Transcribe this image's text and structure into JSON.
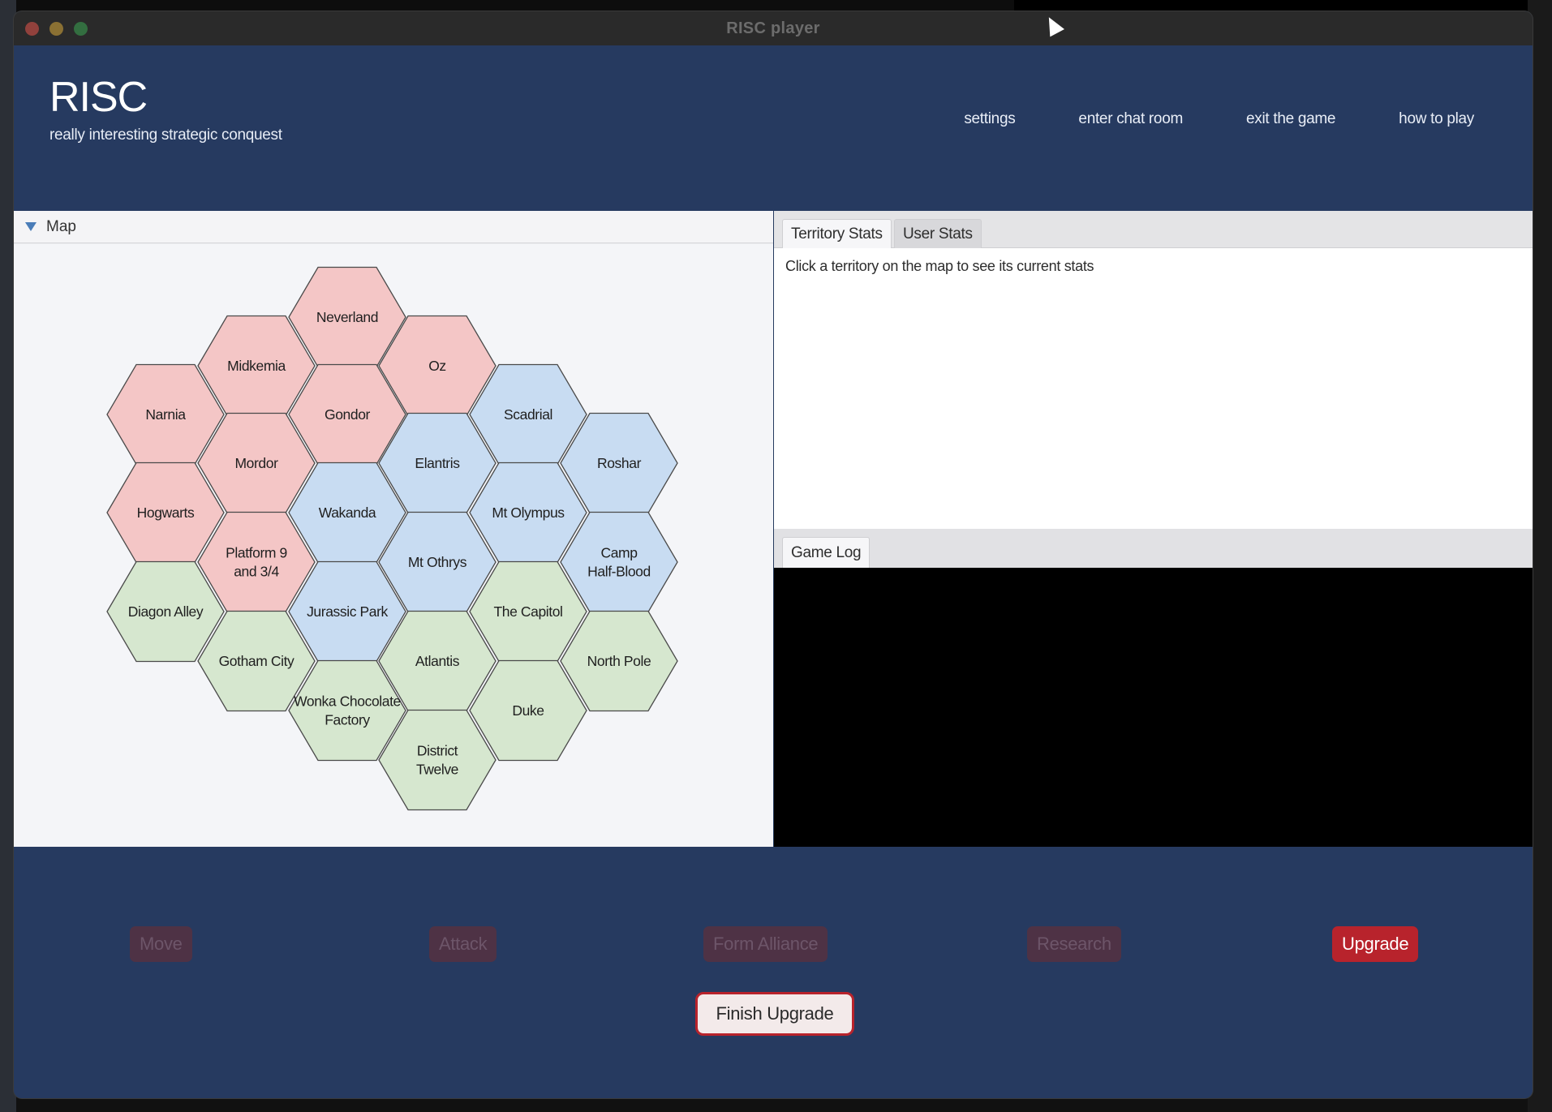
{
  "window": {
    "title": "RISC player"
  },
  "header": {
    "app_title": "RISC",
    "subtitle": "really interesting strategic conquest",
    "nav": [
      "settings",
      "enter chat room",
      "exit the game",
      "how to play"
    ]
  },
  "map": {
    "label": "Map",
    "colors": {
      "red": "#f4c6c6",
      "blue": "#c8dcf2",
      "green": "#d6e7cf",
      "border": "#4a4a4a"
    },
    "territories": [
      {
        "name": "Neverland",
        "owner": "red"
      },
      {
        "name": "Midkemia",
        "owner": "red"
      },
      {
        "name": "Oz",
        "owner": "red"
      },
      {
        "name": "Narnia",
        "owner": "red"
      },
      {
        "name": "Gondor",
        "owner": "red"
      },
      {
        "name": "Scadrial",
        "owner": "blue"
      },
      {
        "name": "Mordor",
        "owner": "red"
      },
      {
        "name": "Elantris",
        "owner": "blue"
      },
      {
        "name": "Roshar",
        "owner": "blue"
      },
      {
        "name": "Hogwarts",
        "owner": "red"
      },
      {
        "name": "Wakanda",
        "owner": "blue"
      },
      {
        "name": "Mt Olympus",
        "owner": "blue"
      },
      {
        "name": "Platform 9\nand 3/4",
        "owner": "red"
      },
      {
        "name": "Mt Othrys",
        "owner": "blue"
      },
      {
        "name": "Camp\nHalf-Blood",
        "owner": "blue"
      },
      {
        "name": "Diagon Alley",
        "owner": "green"
      },
      {
        "name": "Jurassic Park",
        "owner": "blue"
      },
      {
        "name": "The Capitol",
        "owner": "green"
      },
      {
        "name": "Gotham City",
        "owner": "green"
      },
      {
        "name": "Atlantis",
        "owner": "green"
      },
      {
        "name": "North Pole",
        "owner": "green"
      },
      {
        "name": "Wonka Chocolate\nFactory",
        "owner": "green"
      },
      {
        "name": "Duke",
        "owner": "green"
      },
      {
        "name": "District\nTwelve",
        "owner": "green"
      }
    ]
  },
  "stats": {
    "tabs": [
      "Territory Stats",
      "User Stats"
    ],
    "content": "Click a territory on the map to see its current stats"
  },
  "log": {
    "tab": "Game Log"
  },
  "actions": {
    "move": "Move",
    "attack": "Attack",
    "form_alliance": "Form Alliance",
    "research": "Research",
    "upgrade": "Upgrade",
    "finish_upgrade": "Finish Upgrade",
    "colors": {
      "enabled": "#b8232c",
      "disabled": "#4e3245"
    }
  }
}
